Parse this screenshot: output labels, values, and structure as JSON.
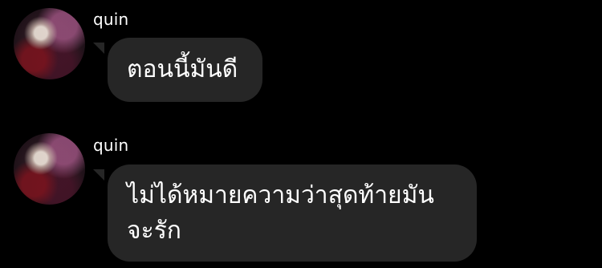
{
  "messages": [
    {
      "sender": "quin",
      "text": "ตอนนี้มันดี"
    },
    {
      "sender": "quin",
      "text": "ไม่ได้หมายความว่าสุดท้ายมัน จะรัก"
    }
  ],
  "colors": {
    "background": "#000000",
    "bubble": "#262626",
    "text": "#ffffff"
  }
}
